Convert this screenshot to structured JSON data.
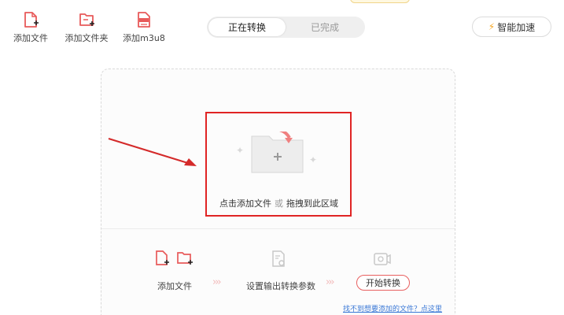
{
  "toolbar": {
    "add_file": "添加文件",
    "add_folder": "添加文件夹",
    "add_m3u8": "添加m3u8"
  },
  "tabs": {
    "converting": "正在转换",
    "completed": "已完成"
  },
  "speed_button": "智能加速",
  "drop_zone": {
    "text_add": "点击添加文件",
    "text_or": "或",
    "text_drag": "拖拽到此区域"
  },
  "steps": {
    "add_file": "添加文件",
    "set_params": "设置输出转换参数",
    "start": "开始转换"
  },
  "help_link": "找不到想要添加的文件？点这里",
  "icons": {
    "add_file": "file-plus-icon",
    "add_folder": "folder-plus-icon",
    "add_m3u8": "m3u8-file-icon",
    "speed": "bolt-icon",
    "folder": "folder-plus-icon",
    "settings": "settings-file-icon",
    "convert": "convert-icon"
  },
  "colors": {
    "accent": "#e85a5a",
    "highlight": "#e02424",
    "link": "#3a78d6",
    "bolt": "#f5a623"
  }
}
